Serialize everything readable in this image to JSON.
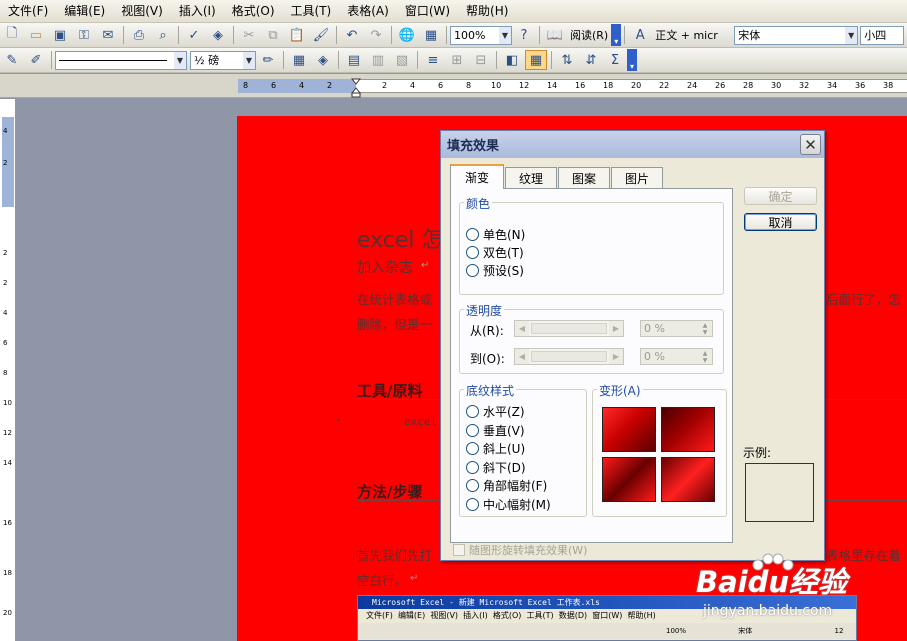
{
  "menubar": {
    "items": [
      "文件(F)",
      "编辑(E)",
      "视图(V)",
      "插入(I)",
      "格式(O)",
      "工具(T)",
      "表格(A)",
      "窗口(W)",
      "帮助(H)"
    ]
  },
  "toolbar1": {
    "zoom": "100%",
    "read_label": "阅读(R)",
    "style": "正文 + micr",
    "font": "宋体",
    "size": "小四"
  },
  "toolbar2": {
    "line_weight": "½ 磅"
  },
  "ruler": {
    "h_numbers": [
      "8",
      "6",
      "4",
      "2",
      "2",
      "4",
      "6",
      "8",
      "10",
      "12",
      "14",
      "16",
      "18",
      "20",
      "22",
      "24",
      "26",
      "28",
      "30",
      "32",
      "34",
      "36",
      "38"
    ],
    "v_numbers": [
      "4",
      "2",
      "2",
      "2",
      "4",
      "6",
      "8",
      "10",
      "12",
      "14",
      "16",
      "18",
      "20"
    ]
  },
  "document": {
    "title": "excel 怎",
    "subtitle": "加入杂志",
    "para1_start": "在统计表格或",
    "para1_end": "后面行了，怎",
    "para2_start": "删除，但是一",
    "heading_tools": "工具/原料",
    "tool_item": "excel",
    "heading_steps": "方法/步骤",
    "step_start": "首先我们先打",
    "step_end": "表格里存在着",
    "step_line2": "空白行。",
    "para_mark": "↵"
  },
  "embedded": {
    "title": "Microsoft Excel - 新建 Microsoft Excel 工作表.xls",
    "menu": [
      "文件(F)",
      "编辑(E)",
      "视图(V)",
      "插入(I)",
      "格式(O)",
      "工具(T)",
      "数据(D)",
      "窗口(W)",
      "帮助(H)"
    ],
    "zoom": "100%",
    "font": "宋体",
    "size": "12"
  },
  "dialog": {
    "title": "填充效果",
    "close": "✕",
    "tabs": [
      "渐变",
      "纹理",
      "图案",
      "图片"
    ],
    "color_group": "颜色",
    "color_options": [
      "单色(N)",
      "双色(T)",
      "预设(S)"
    ],
    "transparency_group": "透明度",
    "from_label": "从(R):",
    "to_label": "到(O):",
    "from_value": "0 %",
    "to_value": "0 %",
    "shading_group": "底纹样式",
    "shading_options": [
      "水平(Z)",
      "垂直(V)",
      "斜上(U)",
      "斜下(D)",
      "角部幅射(F)",
      "中心幅射(M)"
    ],
    "variants_label": "变形(A)",
    "ok": "确定",
    "cancel": "取消",
    "sample_label": "示例:",
    "rotate_label": "随图形旋转填充效果(W)"
  },
  "watermark": {
    "logo": "Baidu经验",
    "url": "jingyan.baidu.com"
  }
}
